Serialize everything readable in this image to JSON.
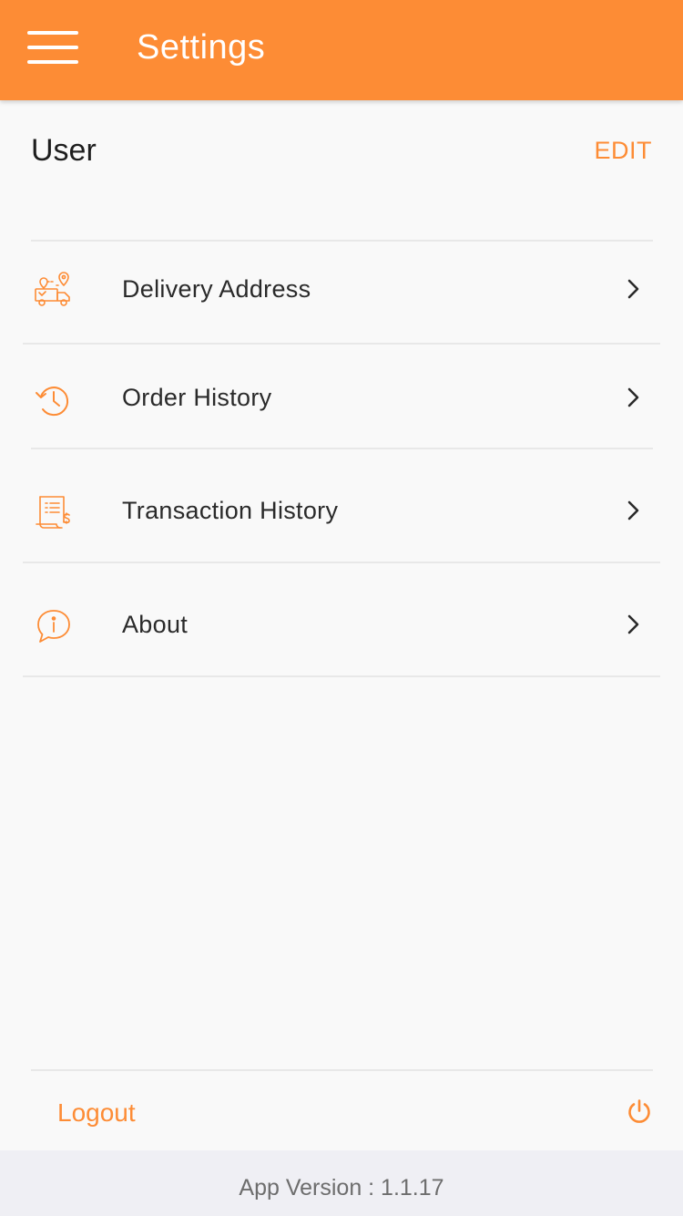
{
  "app_bar": {
    "title": "Settings",
    "menu_icon": "hamburger-menu-icon",
    "background_color": "#fd8c35"
  },
  "user": {
    "name": "User",
    "edit_label": "EDIT"
  },
  "menu_items": [
    {
      "label": "Delivery Address",
      "icon": "delivery-truck-location-icon"
    },
    {
      "label": "Order History",
      "icon": "clock-history-icon"
    },
    {
      "label": "Transaction History",
      "icon": "receipt-document-icon"
    },
    {
      "label": "About",
      "icon": "info-chat-bubble-icon"
    }
  ],
  "logout": {
    "label": "Logout",
    "icon": "power-icon"
  },
  "footer": {
    "version_text": "App Version : 1.1.17"
  },
  "colors": {
    "accent": "#fd8c35",
    "background": "#f9f9f9",
    "footer_background": "#efeff4"
  }
}
